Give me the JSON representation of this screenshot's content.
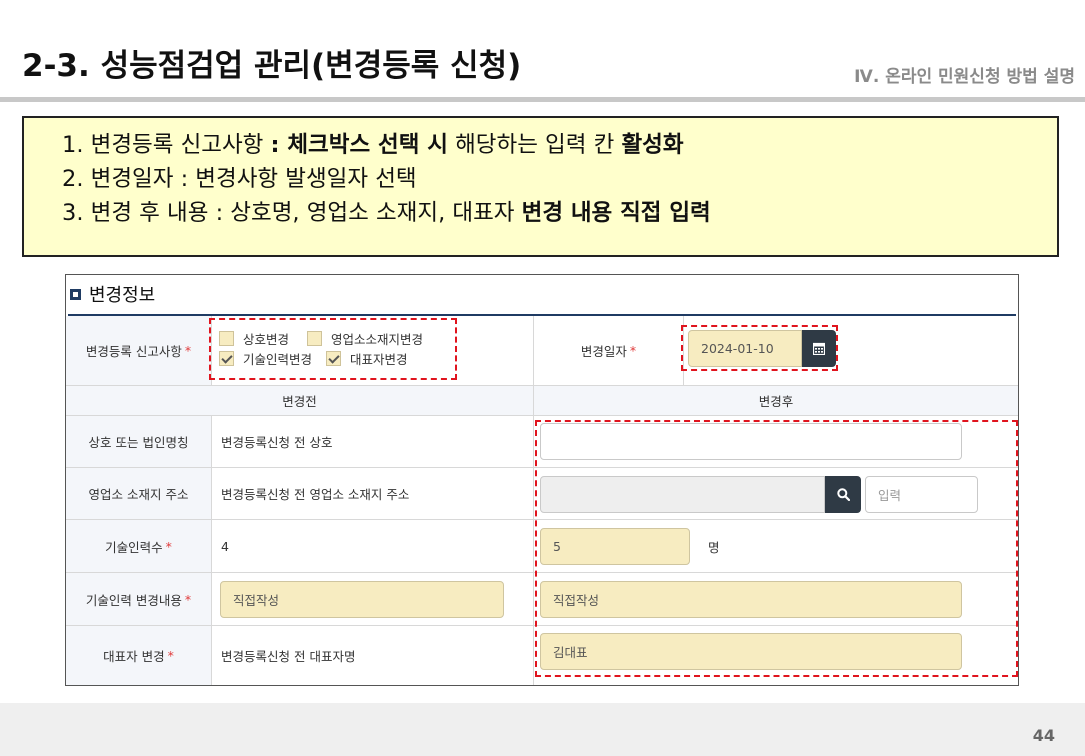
{
  "slide": {
    "title": "2-3. 성능점검업 관리(변경등록 신청)",
    "section": "Ⅳ. 온라인 민원신청 방법 설명",
    "page_number": "44"
  },
  "notes": [
    {
      "plain1": "1. 변경등록 신고사항 ",
      "bold1": " : 체크박스 선택 시",
      "plain2": " 해당하는 입력 칸 ",
      "bold2": "활성화"
    },
    {
      "plain1": "2. 변경일자 : 변경사항 발생일자 선택",
      "bold1": "",
      "plain2": "",
      "bold2": ""
    },
    {
      "plain1": "3. 변경 후 내용 : 상호명, 영업소 소재지, 대표자 ",
      "bold1": "변경 내용 직접 입력",
      "plain2": "",
      "bold2": ""
    }
  ],
  "panel": {
    "title": "변경정보",
    "report_label": "변경등록 신고사항",
    "checkboxes": [
      {
        "label": "상호변경",
        "checked": false
      },
      {
        "label": "영업소소재지변경",
        "checked": false
      },
      {
        "label": "기술인력변경",
        "checked": true
      },
      {
        "label": "대표자변경",
        "checked": true
      }
    ],
    "date_label": "변경일자",
    "date_value": "2024-01-10",
    "required_mark": "*",
    "before_header": "변경전",
    "after_header": "변경후",
    "rows": [
      {
        "label": "상호 또는 법인명칭",
        "required": false,
        "before": "변경등록신청 전 상호",
        "after": ""
      },
      {
        "label": "영업소 소재지 주소",
        "required": false,
        "before": "변경등록신청 전 영업소 소재지 주소",
        "after": "",
        "after_placeholder": "입력"
      },
      {
        "label": "기술인력수",
        "required": true,
        "before": "4",
        "after": "5",
        "after_unit": "명"
      },
      {
        "label": "기술인력 변경내용",
        "required": true,
        "before": "직접작성",
        "after": "직접작성"
      },
      {
        "label": "대표자 변경",
        "required": true,
        "before": "변경등록신청 전 대표자명",
        "after": "김대표"
      }
    ]
  },
  "colors": {
    "accent": "#1f3b63",
    "highlight": "#e0141e",
    "field_yellow": "#f7ecc1",
    "note_bg": "#ffffcc"
  },
  "icons": [
    "calendar-icon",
    "search-icon"
  ]
}
